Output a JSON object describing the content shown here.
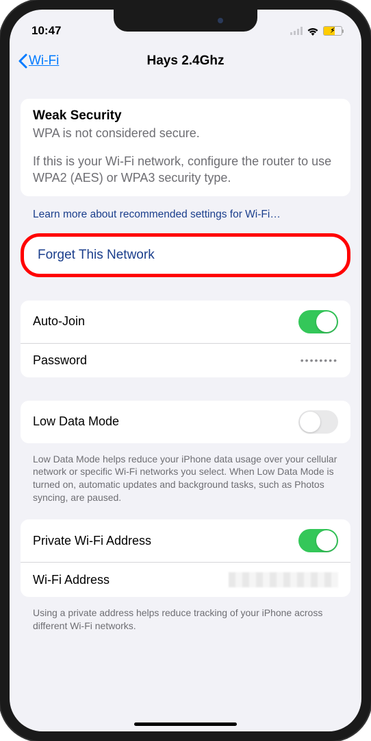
{
  "status": {
    "time": "10:47"
  },
  "nav": {
    "back": "Wi-Fi",
    "title": "Hays 2.4Ghz"
  },
  "security": {
    "title": "Weak Security",
    "subtitle": "WPA is not considered secure.",
    "body": "If this is your Wi-Fi network, configure the router to use WPA2 (AES) or WPA3 security type.",
    "learn_more": "Learn more about recommended settings for Wi-Fi…"
  },
  "forget": {
    "label": "Forget This Network"
  },
  "settings": {
    "auto_join": "Auto-Join",
    "password_label": "Password",
    "password_value": "••••••••",
    "low_data": "Low Data Mode",
    "low_data_desc": "Low Data Mode helps reduce your iPhone data usage over your cellular network or specific Wi-Fi networks you select. When Low Data Mode is turned on, automatic updates and background tasks, such as Photos syncing, are paused.",
    "private_wifi": "Private Wi-Fi Address",
    "wifi_address": "Wi-Fi Address",
    "private_desc": "Using a private address helps reduce tracking of your iPhone across different Wi-Fi networks."
  }
}
